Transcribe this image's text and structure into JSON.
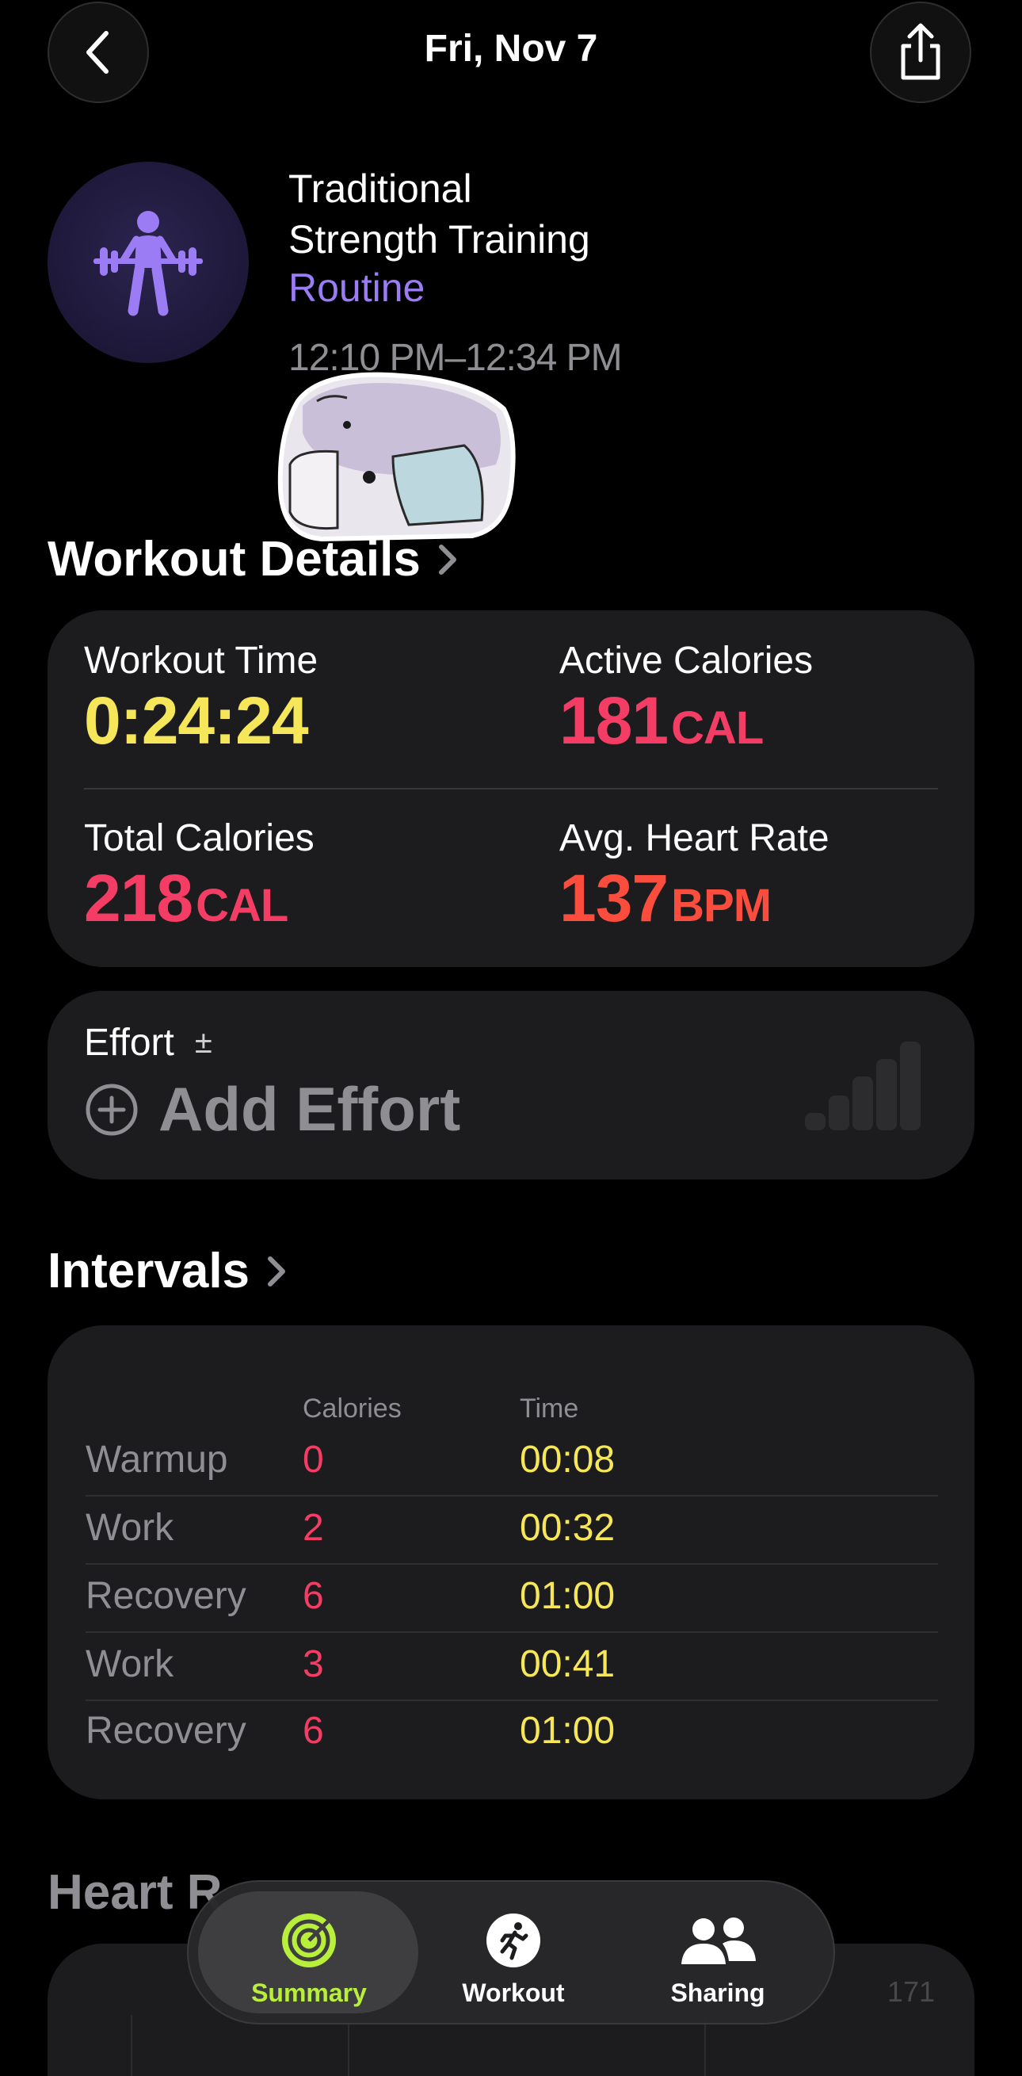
{
  "header": {
    "title": "Fri, Nov 7"
  },
  "workout": {
    "name_line1": "Traditional",
    "name_line2": "Strength Training",
    "type": "Routine",
    "time_range": "12:10 PM–12:34 PM"
  },
  "details": {
    "heading": "Workout Details",
    "workout_time": {
      "label": "Workout Time",
      "value": "0:24:24"
    },
    "active_calories": {
      "label": "Active Calories",
      "value": "181",
      "unit": "CAL"
    },
    "total_calories": {
      "label": "Total Calories",
      "value": "218",
      "unit": "CAL"
    },
    "avg_heart_rate": {
      "label": "Avg. Heart Rate",
      "value": "137",
      "unit": "BPM"
    }
  },
  "effort": {
    "label": "Effort",
    "adjust_symbol": "±",
    "add_label": "Add Effort"
  },
  "intervals": {
    "heading": "Intervals",
    "col_calories": "Calories",
    "col_time": "Time",
    "rows": [
      {
        "name": "Warmup",
        "calories": "0",
        "time": "00:08"
      },
      {
        "name": "Work",
        "calories": "2",
        "time": "00:32"
      },
      {
        "name": "Recovery",
        "calories": "6",
        "time": "01:00"
      },
      {
        "name": "Work",
        "calories": "3",
        "time": "00:41"
      },
      {
        "name": "Recovery",
        "calories": "6",
        "time": "01:00"
      }
    ]
  },
  "heart_rate": {
    "heading_visible": "Heart R",
    "max_label": "171"
  },
  "tabbar": {
    "summary": "Summary",
    "workout": "Workout",
    "sharing": "Sharing",
    "active_color": "#b8ef3b"
  },
  "colors": {
    "time_yellow": "#f5e65a",
    "calorie_pink": "#f43d64",
    "heart_orange": "#fb4d3d",
    "routine_purple": "#9b7cf5"
  }
}
